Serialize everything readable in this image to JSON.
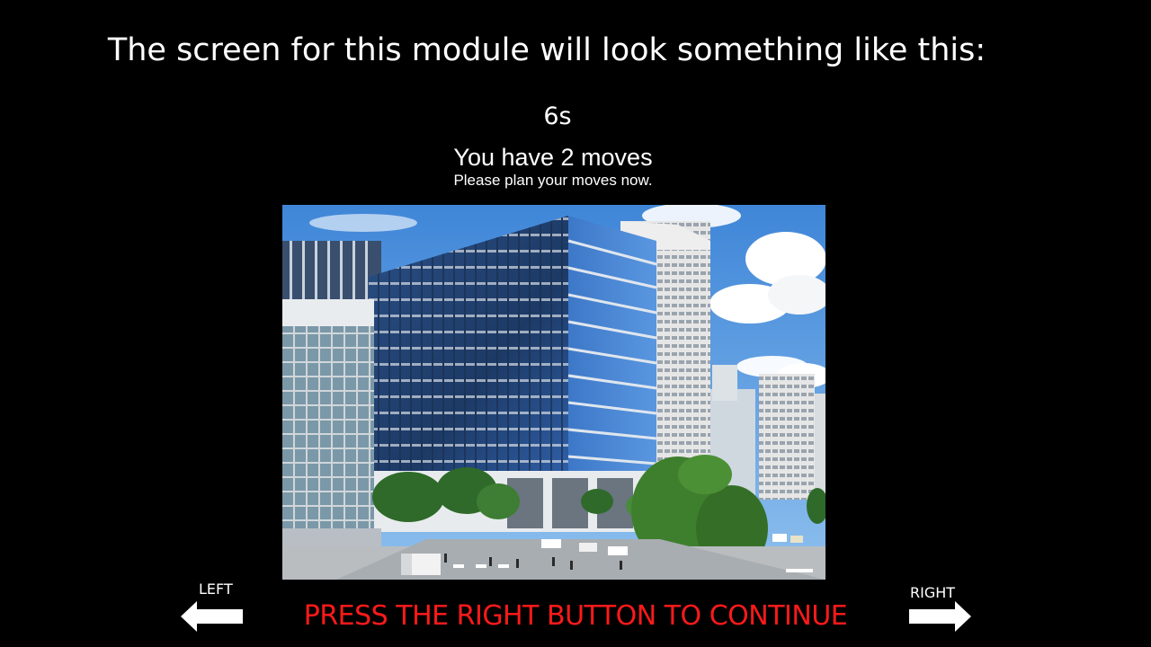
{
  "slide": {
    "title": "The screen for this module will look something like this:"
  },
  "task": {
    "timer": "6s",
    "moves_heading": "You have 2 moves",
    "moves_instruction": "Please plan your moves now."
  },
  "navigation": {
    "left_label": "LEFT",
    "right_label": "RIGHT",
    "continue_prompt": "PRESS THE RIGHT BUTTON TO CONTINUE",
    "left_icon": "arrow-left-icon",
    "right_icon": "arrow-right-icon"
  },
  "colors": {
    "background": "#000000",
    "text": "#ffffff",
    "prompt": "#ff1a1a"
  }
}
